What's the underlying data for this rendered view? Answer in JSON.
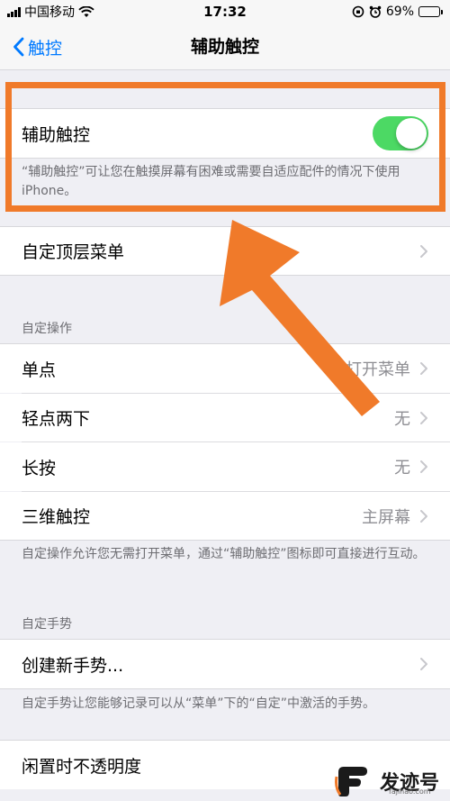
{
  "status_bar": {
    "carrier": "中国移动",
    "time": "17:32",
    "battery_percent": "69%",
    "battery_level": 0.69
  },
  "nav": {
    "back_label": "触控",
    "title": "辅助触控"
  },
  "assistive_touch": {
    "label": "辅助触控",
    "enabled": true,
    "footer": "“辅助触控”可让您在触摸屏幕有困难或需要自适应配件的情况下使用 iPhone。"
  },
  "top_menu": {
    "label": "自定顶层菜单"
  },
  "custom_actions": {
    "header": "自定操作",
    "items": [
      {
        "label": "单点",
        "value": "打开菜单"
      },
      {
        "label": "轻点两下",
        "value": "无"
      },
      {
        "label": "长按",
        "value": "无"
      },
      {
        "label": "三维触控",
        "value": "主屏幕"
      }
    ],
    "footer": "自定操作允许您无需打开菜单，通过“辅助触控”图标即可直接进行互动。"
  },
  "custom_gestures": {
    "header": "自定手势",
    "create_label": "创建新手势...",
    "footer": "自定手势让您能够记录可以从“菜单”下的“自定”中激活的手势。"
  },
  "idle_opacity": {
    "label": "闲置时不透明度"
  },
  "watermark": {
    "name": "发迹号",
    "url": "fajihao.com"
  },
  "colors": {
    "accent": "#007aff",
    "toggle_on": "#4cd964",
    "annotation": "#f07a2a"
  }
}
